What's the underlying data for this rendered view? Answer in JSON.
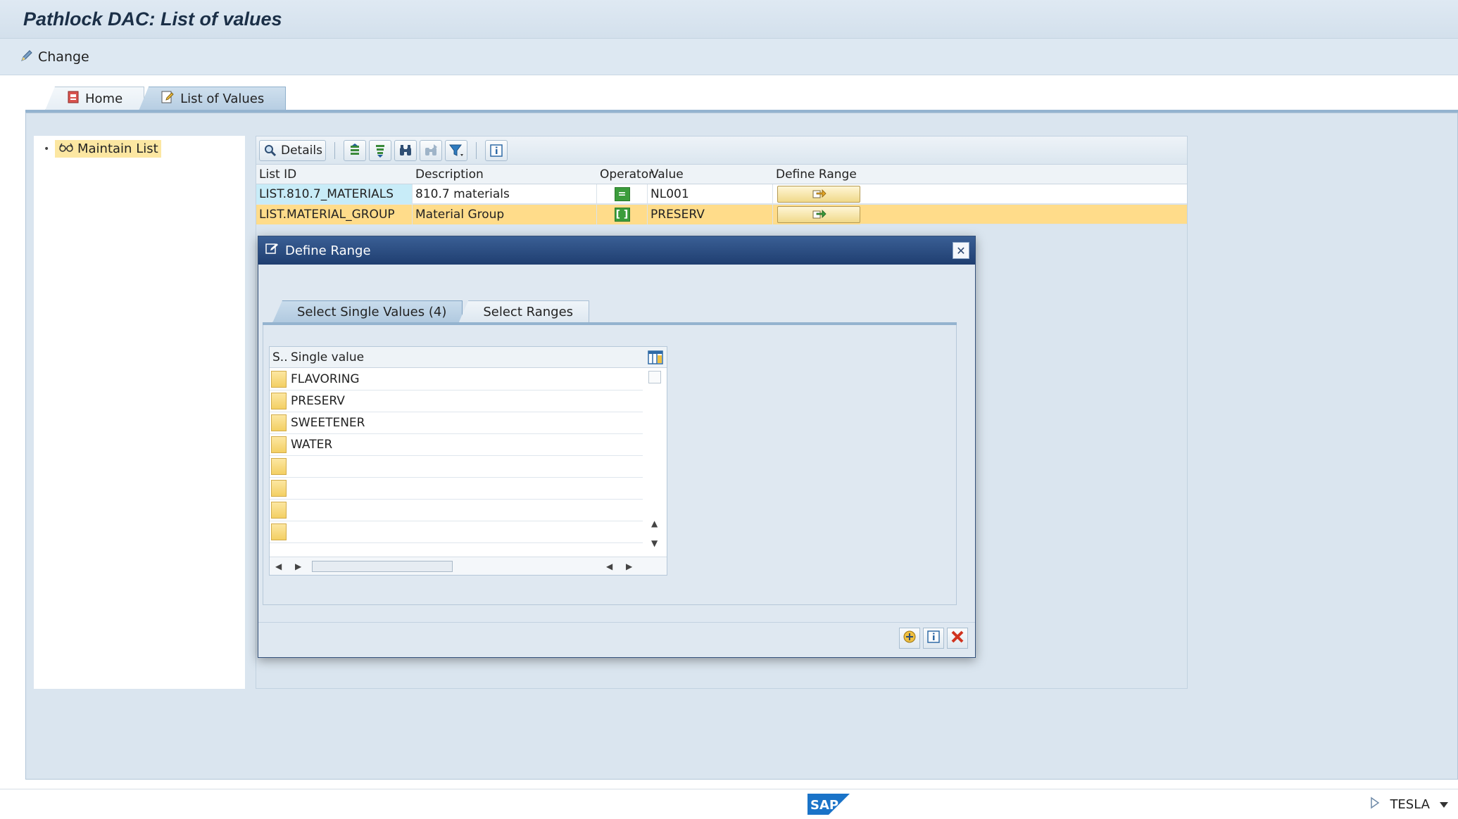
{
  "window": {
    "title": "Pathlock DAC: List of values"
  },
  "app_toolbar": {
    "change_label": "Change"
  },
  "tabs": [
    {
      "label": "Home",
      "icon": "home-icon"
    },
    {
      "label": "List of Values",
      "icon": "edit-document-icon"
    }
  ],
  "tree": {
    "item_label": "Maintain List",
    "icon": "glasses-icon"
  },
  "grid": {
    "toolbar": {
      "details_label": "Details"
    },
    "columns": [
      "List ID",
      "Description",
      "Operator",
      "Value",
      "Define Range"
    ],
    "rows": [
      {
        "list_id": "LIST.810.7_MATERIALS",
        "description": "810.7 materials",
        "operator": "=",
        "value": "NL001"
      },
      {
        "list_id": "LIST.MATERIAL_GROUP",
        "description": "Material Group",
        "operator": "[ ]",
        "value": "PRESERV"
      }
    ]
  },
  "dialog": {
    "title": "Define Range",
    "tabs": [
      "Select Single Values (4)",
      "Select Ranges"
    ],
    "table": {
      "col_selector": "S..",
      "col_value": "Single value",
      "values": [
        "FLAVORING",
        "PRESERV",
        "SWEETENER",
        "WATER",
        "",
        "",
        "",
        ""
      ]
    }
  },
  "statusbar": {
    "system": "TESLA"
  },
  "colors": {
    "accent": "#1f3e70",
    "selected_row": "#ffdc8a",
    "highlight_cell": "#c8ecf8"
  }
}
